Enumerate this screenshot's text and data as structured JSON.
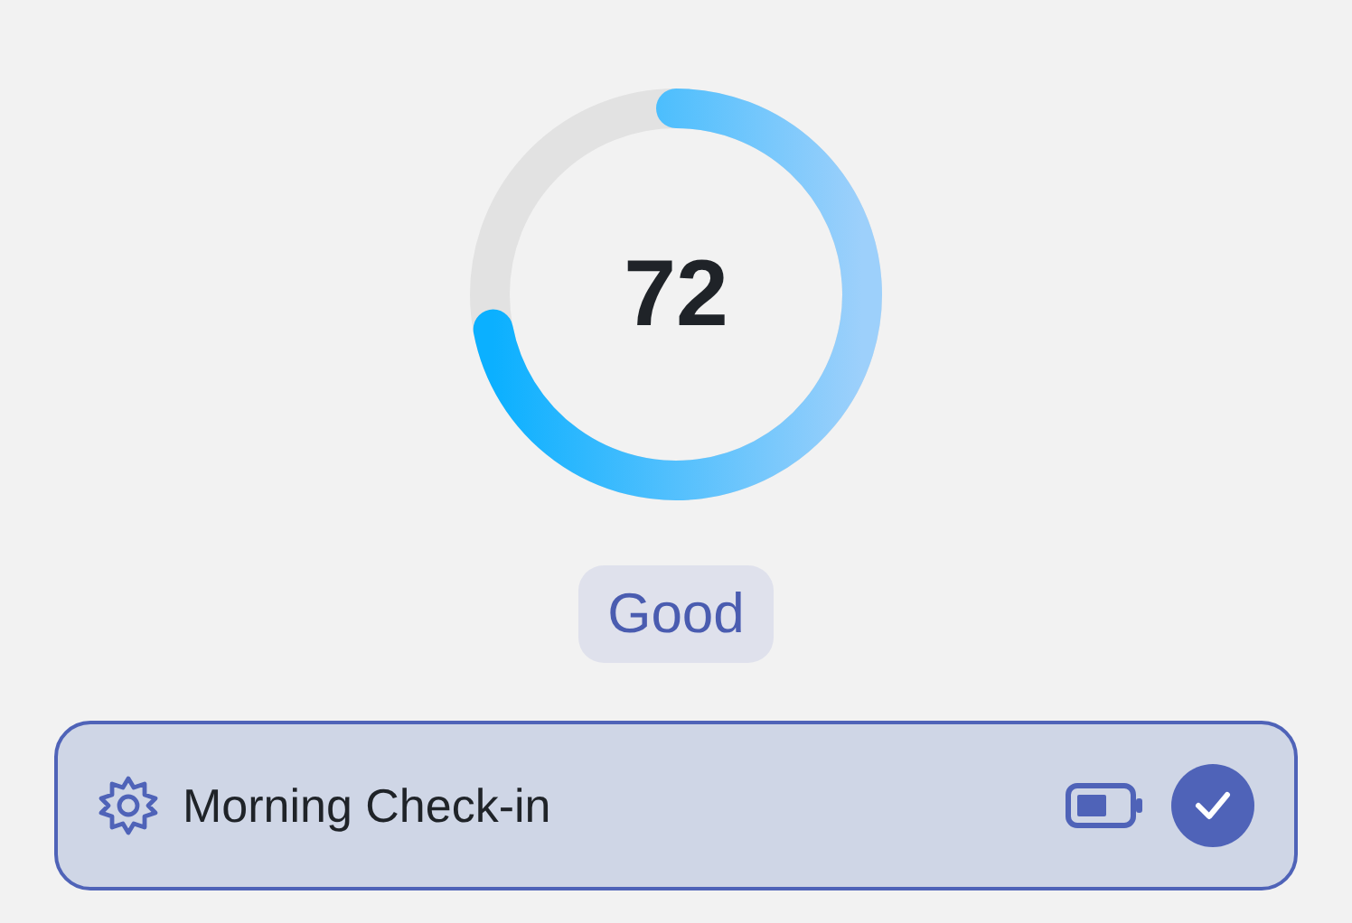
{
  "score": {
    "value": "72"
  },
  "rating": {
    "label": "Good"
  },
  "check_in": {
    "label": "Morning Check-in",
    "checked": true
  }
}
